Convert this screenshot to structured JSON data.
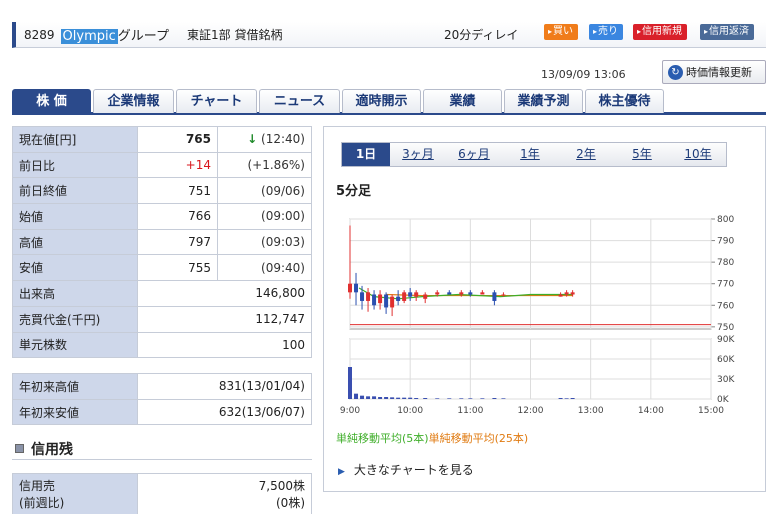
{
  "header": {
    "code": "8289",
    "name_highlight": "Olympic",
    "name_rest": "グループ",
    "market": "東証1部 貸借銘柄",
    "delay": "20分ディレイ",
    "buttons": [
      {
        "label": "買い",
        "color": "#f07c1a"
      },
      {
        "label": "売り",
        "color": "#3a86e0"
      },
      {
        "label": "信用新規",
        "color": "#d9202a"
      },
      {
        "label": "信用返済",
        "color": "#4a6a98"
      }
    ]
  },
  "timestamp": "13/09/09 13:06",
  "refresh_label": "時価情報更新",
  "tabs": [
    "株 価",
    "企業情報",
    "チャート",
    "ニュース",
    "適時開示",
    "業績",
    "業績予測",
    "株主優待"
  ],
  "quote": {
    "current_label": "現在値[円]",
    "current_value": "765",
    "current_arrow": "↓",
    "current_time": "(12:40)",
    "change_label": "前日比",
    "change_value": "+14",
    "change_pct": "(+1.86%)",
    "prev_close_label": "前日終値",
    "prev_close_value": "751",
    "prev_close_date": "(09/06)",
    "open_label": "始値",
    "open_value": "766",
    "open_time": "(09:00)",
    "high_label": "高値",
    "high_value": "797",
    "high_time": "(09:03)",
    "low_label": "安値",
    "low_value": "755",
    "low_time": "(09:40)",
    "volume_label": "出来高",
    "volume_value": "146,800",
    "turnover_label": "売買代金(千円)",
    "turnover_value": "112,747",
    "unit_label": "単元株数",
    "unit_value": "100"
  },
  "yearly": {
    "high_label": "年初来高値",
    "high_value": "831(13/01/04)",
    "low_label": "年初来安値",
    "low_value": "632(13/06/07)"
  },
  "credit": {
    "section_title": "信用残",
    "sell_label": "信用売",
    "sell_value": "7,500株",
    "sell_prev_label": "(前週比)",
    "sell_prev_value": "(0株)"
  },
  "chart_panel": {
    "periods": [
      "1日",
      "3ヶ月",
      "6ヶ月",
      "1年",
      "2年",
      "5年",
      "10年"
    ],
    "title": "5分足",
    "legend_ma5": "単純移動平均(5本)",
    "legend_ma25": "単純移動平均(25本)",
    "legend_ma5_color": "#3fae2a",
    "legend_ma25_color": "#e07a10",
    "link_label": "大きなチャートを見る"
  },
  "chart_data": {
    "type": "candlestick",
    "price_ticks": [
      "800",
      "790",
      "780",
      "770",
      "760",
      "750"
    ],
    "price_range": [
      749,
      800
    ],
    "volume_ticks": [
      "90K",
      "60K",
      "30K",
      "0K"
    ],
    "volume_range": [
      0,
      90000
    ],
    "time_ticks": [
      "9:00",
      "10:00",
      "11:00",
      "12:00",
      "13:00",
      "14:00",
      "15:00"
    ],
    "reference_line": 751,
    "candles": [
      {
        "t": 0.0,
        "o": 766,
        "h": 797,
        "l": 763,
        "c": 770
      },
      {
        "t": 0.1,
        "o": 770,
        "h": 775,
        "l": 760,
        "c": 766
      },
      {
        "t": 0.2,
        "o": 766,
        "h": 769,
        "l": 758,
        "c": 762
      },
      {
        "t": 0.3,
        "o": 762,
        "h": 768,
        "l": 757,
        "c": 766
      },
      {
        "t": 0.4,
        "o": 765,
        "h": 767,
        "l": 758,
        "c": 760
      },
      {
        "t": 0.5,
        "o": 761,
        "h": 767,
        "l": 758,
        "c": 765
      },
      {
        "t": 0.6,
        "o": 765,
        "h": 766,
        "l": 756,
        "c": 759
      },
      {
        "t": 0.7,
        "o": 759,
        "h": 765,
        "l": 755,
        "c": 764
      },
      {
        "t": 0.8,
        "o": 764,
        "h": 767,
        "l": 760,
        "c": 762
      },
      {
        "t": 0.9,
        "o": 762,
        "h": 767,
        "l": 761,
        "c": 766
      },
      {
        "t": 1.0,
        "o": 766,
        "h": 768,
        "l": 762,
        "c": 764
      },
      {
        "t": 1.1,
        "o": 764,
        "h": 767,
        "l": 762,
        "c": 766
      },
      {
        "t": 1.25,
        "o": 763,
        "h": 766,
        "l": 761,
        "c": 765
      },
      {
        "t": 1.45,
        "o": 765,
        "h": 767,
        "l": 764,
        "c": 766
      },
      {
        "t": 1.65,
        "o": 766,
        "h": 767,
        "l": 765,
        "c": 765
      },
      {
        "t": 1.85,
        "o": 765,
        "h": 767,
        "l": 764,
        "c": 766
      },
      {
        "t": 2.0,
        "o": 766,
        "h": 767,
        "l": 764,
        "c": 765
      },
      {
        "t": 2.2,
        "o": 765,
        "h": 767,
        "l": 765,
        "c": 766
      },
      {
        "t": 2.4,
        "o": 766,
        "h": 767,
        "l": 760,
        "c": 762
      },
      {
        "t": 2.55,
        "o": 765,
        "h": 766,
        "l": 764,
        "c": 765
      },
      {
        "t": 3.5,
        "o": 764,
        "h": 766,
        "l": 764,
        "c": 765
      },
      {
        "t": 3.6,
        "o": 765,
        "h": 767,
        "l": 764,
        "c": 766
      },
      {
        "t": 3.7,
        "o": 765,
        "h": 767,
        "l": 764,
        "c": 766
      }
    ],
    "ma5": [
      [
        0.15,
        768
      ],
      [
        0.4,
        764
      ],
      [
        0.8,
        763
      ],
      [
        1.2,
        764
      ],
      [
        1.8,
        765
      ],
      [
        2.5,
        764
      ],
      [
        3.0,
        765
      ],
      [
        3.7,
        765
      ]
    ],
    "ma25": [
      [
        0.6,
        765
      ],
      [
        1.2,
        764.5
      ],
      [
        2.0,
        764.5
      ],
      [
        2.8,
        764.5
      ],
      [
        3.7,
        764.5
      ]
    ],
    "volumes": [
      {
        "t": 0.0,
        "v": 48000
      },
      {
        "t": 0.1,
        "v": 8000
      },
      {
        "t": 0.2,
        "v": 5000
      },
      {
        "t": 0.3,
        "v": 4000
      },
      {
        "t": 0.4,
        "v": 4000
      },
      {
        "t": 0.5,
        "v": 3000
      },
      {
        "t": 0.6,
        "v": 3000
      },
      {
        "t": 0.7,
        "v": 2500
      },
      {
        "t": 0.8,
        "v": 2000
      },
      {
        "t": 0.9,
        "v": 2000
      },
      {
        "t": 1.0,
        "v": 2000
      },
      {
        "t": 1.1,
        "v": 1500
      },
      {
        "t": 1.25,
        "v": 1500
      },
      {
        "t": 1.45,
        "v": 1000
      },
      {
        "t": 1.65,
        "v": 1000
      },
      {
        "t": 1.85,
        "v": 1000
      },
      {
        "t": 2.0,
        "v": 1000
      },
      {
        "t": 2.2,
        "v": 1000
      },
      {
        "t": 2.4,
        "v": 1500
      },
      {
        "t": 2.55,
        "v": 1000
      },
      {
        "t": 3.5,
        "v": 1500
      },
      {
        "t": 3.6,
        "v": 1000
      },
      {
        "t": 3.7,
        "v": 1500
      }
    ]
  }
}
